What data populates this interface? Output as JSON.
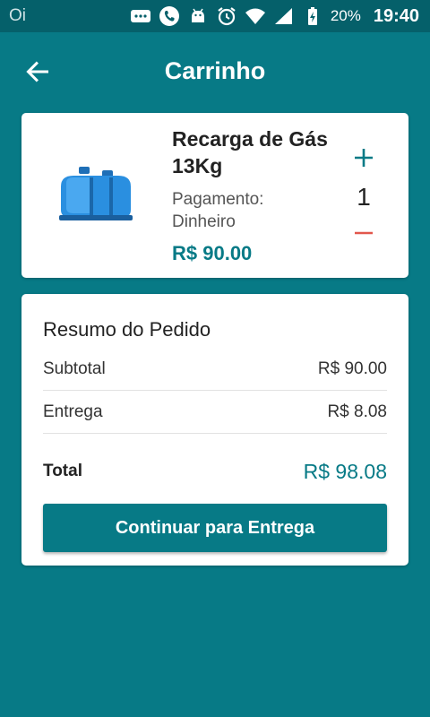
{
  "status_bar": {
    "carrier": "Oi",
    "battery_percent": "20%",
    "time": "19:40",
    "icons": [
      "chat-icon",
      "phone-icon",
      "android-icon",
      "alarm-icon",
      "wifi-icon",
      "signal-icon",
      "battery-charging-icon"
    ]
  },
  "header": {
    "title": "Carrinho",
    "back_icon": "arrow-back-icon"
  },
  "cart_item": {
    "name": "Recarga de Gás 13Kg",
    "payment_label": "Pagamento:",
    "payment_method": "Dinheiro",
    "price": "R$ 90.00",
    "quantity": "1",
    "image_icon": "gas-cylinder-icon"
  },
  "summary": {
    "title": "Resumo do Pedido",
    "subtotal_label": "Subtotal",
    "subtotal_value": "R$ 90.00",
    "delivery_label": "Entrega",
    "delivery_value": "R$ 8.08",
    "total_label": "Total",
    "total_value": "R$ 98.08",
    "continue_label": "Continuar para Entrega"
  },
  "colors": {
    "primary": "#077a86",
    "status_bar": "#05606a",
    "minus": "#e2574c"
  }
}
